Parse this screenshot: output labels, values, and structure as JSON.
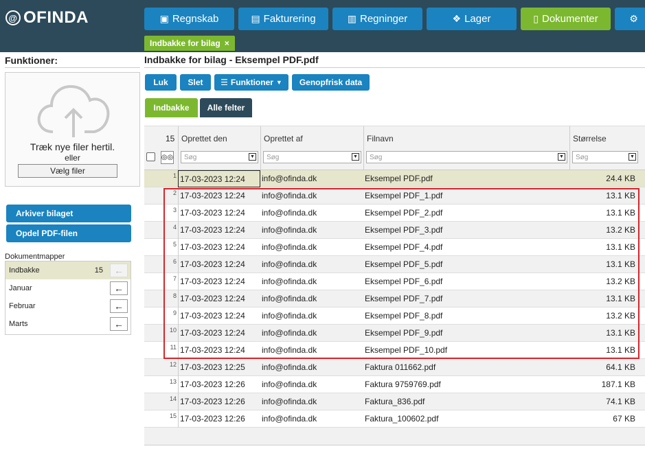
{
  "app": {
    "logo_mark": "@",
    "logo_text": "OFINDA",
    "nav": [
      {
        "label": "Regnskab",
        "icon": "calendar-icon",
        "glyph": "▣",
        "active": false
      },
      {
        "label": "Fakturering",
        "icon": "clipboard-icon",
        "glyph": "▤",
        "active": false
      },
      {
        "label": "Regninger",
        "icon": "bar-chart-icon",
        "glyph": "▥",
        "active": false
      },
      {
        "label": "Lager",
        "icon": "cubes-icon",
        "glyph": "❖",
        "active": false
      },
      {
        "label": "Dokumenter",
        "icon": "document-icon",
        "glyph": "▯",
        "active": true
      },
      {
        "label": "",
        "icon": "gear-icon",
        "glyph": "⚙",
        "active": false
      }
    ],
    "open_tab": {
      "label": "Indbakke for bilag",
      "close": "×"
    }
  },
  "left": {
    "title": "Funktioner:",
    "drop_text": "Træk nye filer hertil.",
    "drop_or": "eller",
    "choose_label": "Vælg filer",
    "actions": [
      "Arkiver bilaget",
      "Opdel PDF-filen"
    ],
    "folders_title": "Dokumentmapper",
    "folders": [
      {
        "name": "Indbakke",
        "count": "15",
        "selected": true
      },
      {
        "name": "Januar",
        "count": "",
        "selected": false
      },
      {
        "name": "Februar",
        "count": "",
        "selected": false
      },
      {
        "name": "Marts",
        "count": "",
        "selected": false
      }
    ],
    "arrow": "←"
  },
  "main": {
    "title": "Indbakke for bilag - Eksempel PDF.pdf",
    "toolbar": {
      "close": "Luk",
      "delete": "Slet",
      "functions": "Funktioner",
      "refresh": "Genopfrisk data"
    },
    "view_tabs": [
      {
        "label": "Indbakke",
        "active": true
      },
      {
        "label": "Alle felter",
        "active": false
      }
    ]
  },
  "grid": {
    "count": "15",
    "columns": {
      "created": "Oprettet den",
      "created_by": "Oprettet af",
      "filename": "Filnavn",
      "size": "Størrelse"
    },
    "filter_placeholder": "Søg",
    "rows": [
      {
        "n": "1",
        "date": "17-03-2023 12:24",
        "by": "info@ofinda.dk",
        "file": "Eksempel PDF.pdf",
        "size": "24.4 KB"
      },
      {
        "n": "2",
        "date": "17-03-2023 12:24",
        "by": "info@ofinda.dk",
        "file": "Eksempel PDF_1.pdf",
        "size": "13.1 KB"
      },
      {
        "n": "3",
        "date": "17-03-2023 12:24",
        "by": "info@ofinda.dk",
        "file": "Eksempel PDF_2.pdf",
        "size": "13.1 KB"
      },
      {
        "n": "4",
        "date": "17-03-2023 12:24",
        "by": "info@ofinda.dk",
        "file": "Eksempel PDF_3.pdf",
        "size": "13.2 KB"
      },
      {
        "n": "5",
        "date": "17-03-2023 12:24",
        "by": "info@ofinda.dk",
        "file": "Eksempel PDF_4.pdf",
        "size": "13.1 KB"
      },
      {
        "n": "6",
        "date": "17-03-2023 12:24",
        "by": "info@ofinda.dk",
        "file": "Eksempel PDF_5.pdf",
        "size": "13.1 KB"
      },
      {
        "n": "7",
        "date": "17-03-2023 12:24",
        "by": "info@ofinda.dk",
        "file": "Eksempel PDF_6.pdf",
        "size": "13.2 KB"
      },
      {
        "n": "8",
        "date": "17-03-2023 12:24",
        "by": "info@ofinda.dk",
        "file": "Eksempel PDF_7.pdf",
        "size": "13.1 KB"
      },
      {
        "n": "9",
        "date": "17-03-2023 12:24",
        "by": "info@ofinda.dk",
        "file": "Eksempel PDF_8.pdf",
        "size": "13.2 KB"
      },
      {
        "n": "10",
        "date": "17-03-2023 12:24",
        "by": "info@ofinda.dk",
        "file": "Eksempel PDF_9.pdf",
        "size": "13.1 KB"
      },
      {
        "n": "11",
        "date": "17-03-2023 12:24",
        "by": "info@ofinda.dk",
        "file": "Eksempel PDF_10.pdf",
        "size": "13.1 KB"
      },
      {
        "n": "12",
        "date": "17-03-2023 12:25",
        "by": "info@ofinda.dk",
        "file": "Faktura 011662.pdf",
        "size": "64.1 KB"
      },
      {
        "n": "13",
        "date": "17-03-2023 12:26",
        "by": "info@ofinda.dk",
        "file": "Faktura 9759769.pdf",
        "size": "187.1 KB"
      },
      {
        "n": "14",
        "date": "17-03-2023 12:26",
        "by": "info@ofinda.dk",
        "file": "Faktura_836.pdf",
        "size": "74.1 KB"
      },
      {
        "n": "15",
        "date": "17-03-2023 12:26",
        "by": "info@ofinda.dk",
        "file": "Faktura_100602.pdf",
        "size": "67 KB"
      }
    ]
  },
  "colors": {
    "topbar": "#2c4a5a",
    "primary": "#1a83c0",
    "green": "#7cb82f",
    "dark_tab": "#2c4a5a",
    "highlight": "#d8232a",
    "selected_row": "#e6e6cc"
  }
}
